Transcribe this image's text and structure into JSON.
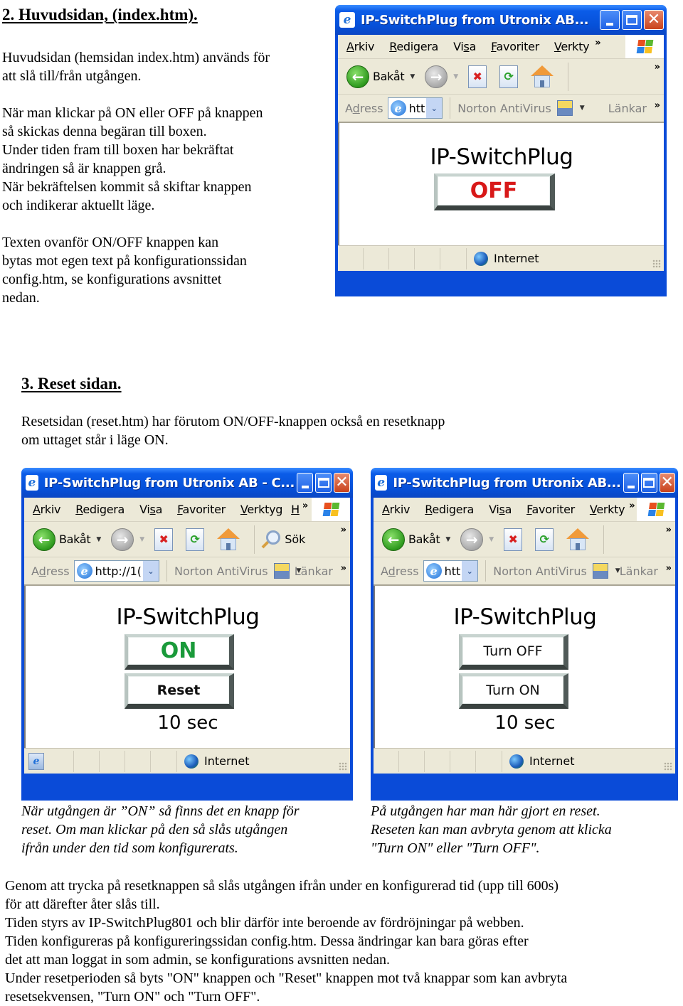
{
  "section2": {
    "heading": "2. Huvudsidan, (index.htm).",
    "para1": [
      "Huvudsidan (hemsidan index.htm) används för",
      "att slå till/från utgången."
    ],
    "para2": [
      "När man klickar på  ON eller OFF på knappen",
      "så skickas denna begäran till boxen.",
      "Under tiden fram till boxen har bekräftat",
      "ändringen så är knappen grå.",
      "När bekräftelsen kommit så skiftar knappen",
      "och indikerar aktuellt läge."
    ],
    "para3": [
      "Texten ovanför ON/OFF knappen kan",
      "bytas mot egen text på konfigurationssidan",
      "config.htm, se konfigurations avsnittet",
      "nedan."
    ]
  },
  "browser1": {
    "title": "IP-SwitchPlug from Utronix AB...",
    "menu": [
      {
        "key": "A",
        "rest": "rkiv"
      },
      {
        "key": "R",
        "rest": "edigera"
      },
      {
        "pre": "Vi",
        "key": "s",
        "rest": "a"
      },
      {
        "key": "F",
        "rest": "avoriter"
      },
      {
        "key": "V",
        "rest": "erkty"
      }
    ],
    "back_label": "Bakåt",
    "address_label_pre": "A",
    "address_label_key": "d",
    "address_label_post": "ress",
    "address_value": "htt",
    "norton_label": "Norton AntiVirus",
    "links_label": "Länkar",
    "chevron": "»",
    "page": {
      "brand": "IP-SwitchPlug",
      "button": "OFF"
    },
    "status_zone": "Internet"
  },
  "section3": {
    "heading": "3. Reset sidan.",
    "para": [
      "Resetsidan (reset.htm) har förutom ON/OFF-knappen också en resetknapp",
      "om uttaget står i läge ON."
    ]
  },
  "browser2": {
    "title": "IP-SwitchPlug from Utronix AB - C...",
    "menu": [
      {
        "key": "A",
        "rest": "rkiv"
      },
      {
        "key": "R",
        "rest": "edigera"
      },
      {
        "pre": "Vi",
        "key": "s",
        "rest": "a"
      },
      {
        "key": "F",
        "rest": "avoriter"
      },
      {
        "key": "V",
        "rest": "erktyg"
      },
      {
        "key": "H",
        "rest": ""
      }
    ],
    "back_label": "Bakåt",
    "search_label": "Sök",
    "address_value": "http://1(",
    "norton_label": "Norton AntiVirus",
    "links_label": "Länkar",
    "page": {
      "brand": "IP-SwitchPlug",
      "button1": "ON",
      "button2": "Reset",
      "timer": "10 sec"
    },
    "status_zone": "Internet",
    "caption": [
      "När utgången är ”ON” så finns det en knapp för",
      "reset. Om man klickar på den så slås utgången",
      "ifrån under den tid som konfigurerats."
    ]
  },
  "browser3": {
    "title": "IP-SwitchPlug from Utronix AB...",
    "menu": [
      {
        "key": "A",
        "rest": "rkiv"
      },
      {
        "key": "R",
        "rest": "edigera"
      },
      {
        "pre": "Vi",
        "key": "s",
        "rest": "a"
      },
      {
        "key": "F",
        "rest": "avoriter"
      },
      {
        "key": "V",
        "rest": "erkty"
      }
    ],
    "back_label": "Bakåt",
    "address_value": "htt",
    "norton_label": "Norton AntiVirus",
    "links_label": "Länkar",
    "page": {
      "brand": "IP-SwitchPlug",
      "button1": "Turn OFF",
      "button2": "Turn ON",
      "timer": "10 sec"
    },
    "status_zone": "Internet",
    "caption": [
      "På utgången har man här gjort en reset.",
      "Reseten kan man   avbryta genom att klicka",
      "\"Turn ON\"  eller \"Turn OFF\"."
    ]
  },
  "footer": [
    "Genom att trycka på resetknappen så slås utgången ifrån under en konfigurerad tid (upp till 600s)",
    "för att därefter åter slås till.",
    "Tiden styrs av IP-SwitchPlug801 och blir därför inte beroende av fördröjningar på webben.",
    "Tiden konfigureras på konfigureringssidan  config.htm. Dessa ändringar kan bara göras efter",
    "det att man loggat in som admin, se konfigurations avsnitten nedan.",
    "Under resetperioden så byts \"ON\" knappen och \"Reset\" knappen mot två knappar som kan avbryta",
    "resetsekvensen, \"Turn ON\" och \"Turn OFF\"."
  ],
  "colors": {
    "off": "#D81818",
    "on": "#1A9A3A",
    "xp_title": "#0650D8",
    "xp_chrome": "#ECE9D8"
  }
}
